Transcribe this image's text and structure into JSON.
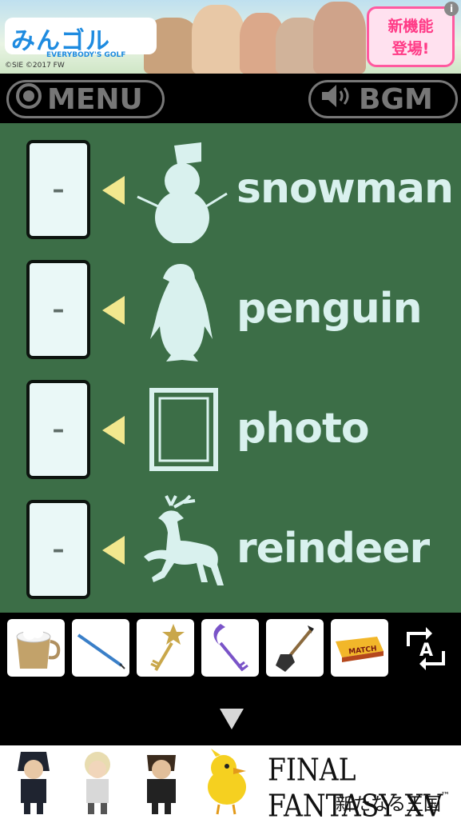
{
  "ad_top": {
    "logo": "みんゴル",
    "logo_sub": "EVERYBODY'S GOLF",
    "copyright": "©SIE ©2017 FW",
    "badge_line1": "新機能",
    "badge_line2": "登場!",
    "info": "i"
  },
  "toolbar": {
    "menu_label": "MENU",
    "bgm_label": "BGM"
  },
  "puzzle": {
    "rows": [
      {
        "word": "snowman",
        "slot_value": "–",
        "icon": "snowman-icon"
      },
      {
        "word": "penguin",
        "slot_value": "–",
        "icon": "penguin-icon"
      },
      {
        "word": "photo",
        "slot_value": "–",
        "icon": "photo-frame-icon"
      },
      {
        "word": "reindeer",
        "slot_value": "–",
        "icon": "reindeer-icon"
      }
    ]
  },
  "inventory": {
    "items": [
      "cup-with-snow-icon",
      "pencil-icon",
      "star-key-icon",
      "moon-key-icon",
      "shovel-icon",
      "matchbox-icon"
    ],
    "match_label": "MATCH",
    "swap_label": "A"
  },
  "ad_bottom": {
    "title": "FINAL FANTASY XV",
    "subtitle": "新たなる王国",
    "tm": "™"
  },
  "colors": {
    "board": "#3c6e47",
    "word": "#d9f1ee",
    "arrow": "#f2e88e",
    "slot": "#eaf8f7"
  }
}
